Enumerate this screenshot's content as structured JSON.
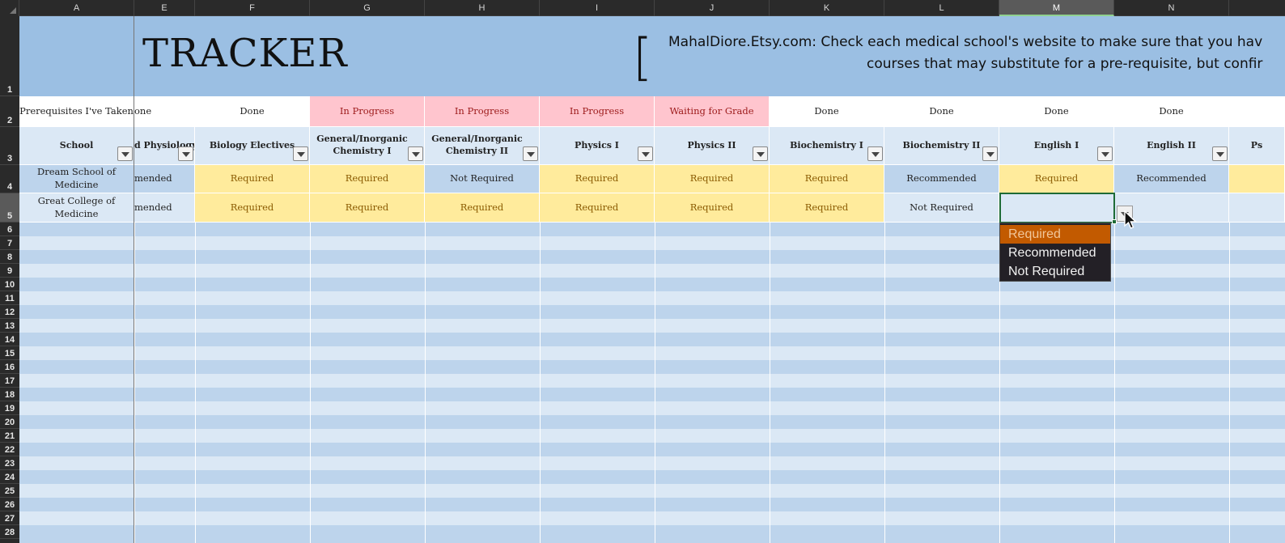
{
  "columns": [
    "A",
    "E",
    "F",
    "G",
    "H",
    "I",
    "J",
    "K",
    "L",
    "M",
    "N",
    ""
  ],
  "active_column": "M",
  "rows": [
    "1",
    "2",
    "3",
    "4",
    "5",
    "6",
    "7",
    "8",
    "9",
    "10",
    "11",
    "12",
    "13",
    "14",
    "15",
    "16",
    "17",
    "18",
    "19",
    "20",
    "21",
    "22",
    "23",
    "24",
    "25",
    "26",
    "27",
    "28"
  ],
  "active_row": "5",
  "header": {
    "title": "TRACKER",
    "bracket": "[",
    "note_line1": "MahalDiore.Etsy.com: Check each medical school's website to make sure that you hav",
    "note_line2": "courses that may substitute for a pre-requisite, but confir"
  },
  "row2": {
    "label": "Prerequisites I've Taken",
    "statuses": [
      "one",
      "Done",
      "In Progress",
      "In Progress",
      "In Progress",
      "Waiting for Grade",
      "Done",
      "Done",
      "Done",
      "Done",
      ""
    ]
  },
  "row3": {
    "school_label": "School",
    "courses": [
      "d Physiology",
      "Biology Electives",
      "General/Inorganic Chemistry I",
      "General/Inorganic Chemistry II",
      "Physics I",
      "Physics II",
      "Biochemistry I",
      "Biochemistry II",
      "English I",
      "English II",
      "Ps"
    ]
  },
  "schools": [
    {
      "name": "Dream School of Medicine",
      "values": [
        "mended",
        "Required",
        "Required",
        "Not Required",
        "Required",
        "Required",
        "Required",
        "Recommended",
        "Required",
        "Recommended",
        ""
      ]
    },
    {
      "name": "Great College of Medicine",
      "values": [
        "mended",
        "Required",
        "Required",
        "Required",
        "Required",
        "Required",
        "Required",
        "Not Required",
        "",
        "",
        ""
      ]
    }
  ],
  "dropdown": {
    "options": [
      "Required",
      "Recommended",
      "Not Required"
    ],
    "highlighted": "Required"
  },
  "colors": {
    "required_bg": "#ffeb9c",
    "in_progress_bg": "#ffc5ce",
    "header_bg": "#9bbfe3",
    "selection": "#1e6b36",
    "dropdown_highlight": "#c25a00"
  }
}
